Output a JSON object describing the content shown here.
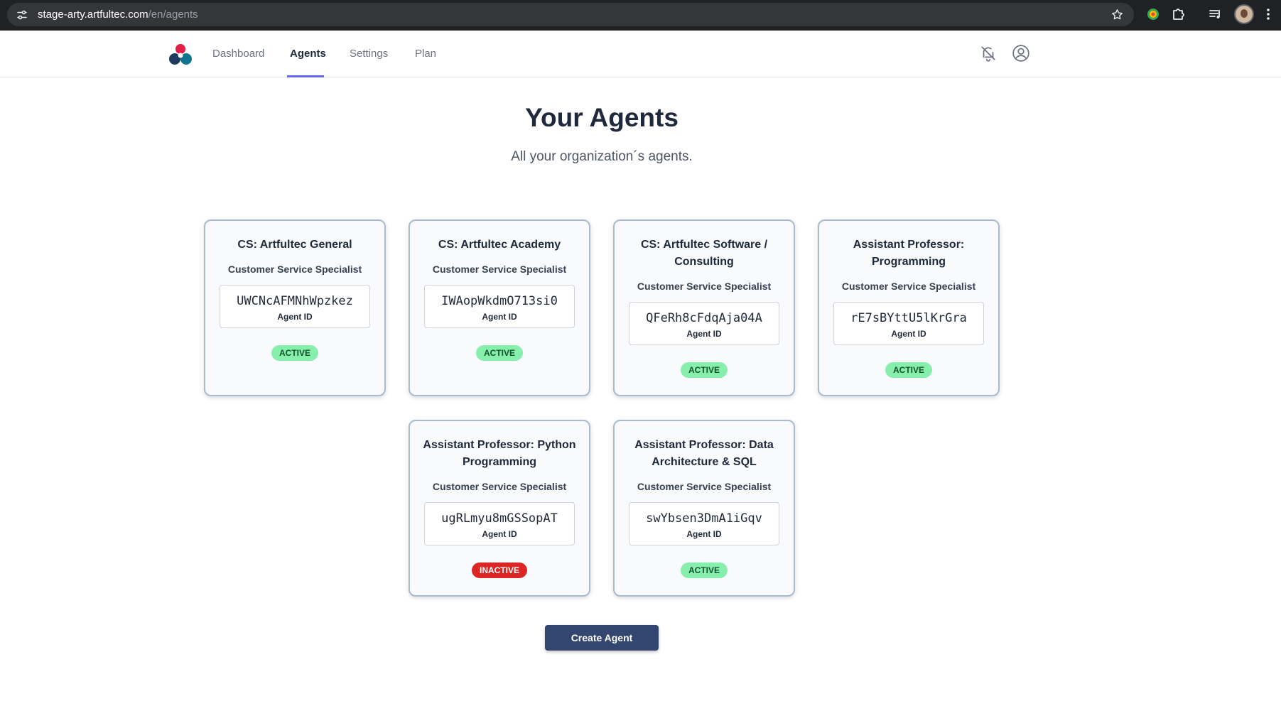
{
  "browser": {
    "url_host": "stage-arty.artfultec.com",
    "url_path": "/en/agents"
  },
  "nav": {
    "links": [
      {
        "label": "Dashboard",
        "active": false
      },
      {
        "label": "Agents",
        "active": true
      },
      {
        "label": "Settings",
        "active": false
      },
      {
        "label": "Plan",
        "active": false
      }
    ]
  },
  "header": {
    "title": "Your Agents",
    "subtitle": "All your organization´s agents."
  },
  "agents": [
    {
      "name": "CS: Artfultec General",
      "role": "Customer Service Specialist",
      "id": "UWCNcAFMNhWpzkez",
      "id_label": "Agent ID",
      "status": "ACTIVE"
    },
    {
      "name": "CS: Artfultec Academy",
      "role": "Customer Service Specialist",
      "id": "IWAopWkdmO713si0",
      "id_label": "Agent ID",
      "status": "ACTIVE"
    },
    {
      "name": "CS: Artfultec Software / Consulting",
      "role": "Customer Service Specialist",
      "id": "QFeRh8cFdqAja04A",
      "id_label": "Agent ID",
      "status": "ACTIVE"
    },
    {
      "name": "Assistant Professor: Programming",
      "role": "Customer Service Specialist",
      "id": "rE7sBYttU5lKrGra",
      "id_label": "Agent ID",
      "status": "ACTIVE"
    },
    {
      "name": "Assistant Professor: Python Programming",
      "role": "Customer Service Specialist",
      "id": "ugRLmyu8mGSSopAT",
      "id_label": "Agent ID",
      "status": "INACTIVE"
    },
    {
      "name": "Assistant Professor: Data Architecture & SQL",
      "role": "Customer Service Specialist",
      "id": "swYbsen3DmA1iGqv",
      "id_label": "Agent ID",
      "status": "ACTIVE"
    }
  ],
  "actions": {
    "create_label": "Create Agent"
  },
  "colors": {
    "accent": "#6366f1",
    "primary_button": "#334670",
    "active_badge": "#86efac",
    "inactive_badge": "#dc2626"
  },
  "icons": [
    "tune-icon",
    "star-icon",
    "extension-icon",
    "puzzle-icon",
    "media-control-icon",
    "kebab-menu-icon",
    "notifications-off-icon",
    "account-circle-icon"
  ]
}
